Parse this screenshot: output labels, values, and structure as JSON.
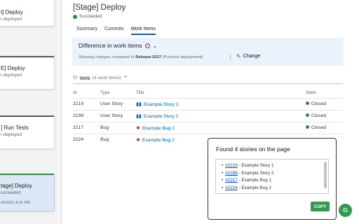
{
  "pipeline": {
    "cards": [
      {
        "title": "t] Deploy",
        "subtitle": "t deployed"
      },
      {
        "title": "E] Deploy",
        "subtitle": "t deployed"
      },
      {
        "title": "] Run Tests",
        "subtitle": "t deployed"
      },
      {
        "title": "tage] Deploy",
        "subtitle": "ucceeded",
        "date": "/4/2023, 8:41 PM"
      }
    ]
  },
  "header": {
    "title": "[Stage] Deploy",
    "status": "Succeeded"
  },
  "tabs": [
    "Summary",
    "Commits",
    "Work Items"
  ],
  "banner": {
    "heading": "Difference in work items",
    "compare_prefix": "Showing changes compared to ",
    "release": "Release-2317",
    "compare_suffix": " (Previous deployment)",
    "change_label": "Change"
  },
  "group": {
    "name": "Web",
    "count": "(4 work items)"
  },
  "table": {
    "headers": [
      "Id",
      "Type",
      "Title",
      "State"
    ],
    "rows": [
      {
        "id": "2219",
        "type": "User Story",
        "title": "Example Story 1",
        "state": "Closed",
        "kind": "story"
      },
      {
        "id": "2199",
        "type": "User Story",
        "title": "Example Story 2",
        "state": "Closed",
        "kind": "story"
      },
      {
        "id": "2217",
        "type": "Bug",
        "title": "Example Bug 1",
        "state": "Closed",
        "kind": "bug"
      },
      {
        "id": "2224",
        "type": "Bug",
        "title": "Example Bug 2",
        "state": "",
        "kind": "bug"
      }
    ]
  },
  "popup": {
    "heading": "Found 4 stories on the page",
    "items": [
      {
        "link": "#2219",
        "text": " - Example Story 1"
      },
      {
        "link": "#2199",
        "text": " - Example Story 2"
      },
      {
        "link": "#2217",
        "text": " - Example Bug 1"
      },
      {
        "link": "#2224",
        "text": " - Example Bug 2"
      }
    ],
    "copy_label": "COPY"
  },
  "colors": {
    "success": "#2e8b3a",
    "accent": "#0067b8",
    "copy": "#2e9b4f",
    "bug": "#cc2929"
  }
}
